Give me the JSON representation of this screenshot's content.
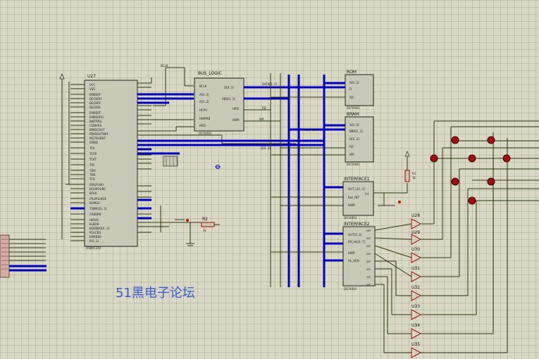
{
  "components": {
    "u27": {
      "title": "U27",
      "part": "DS80C320",
      "pins_left": [
        "VCC",
        "VSS",
        "EMBSRF",
        "DECKDH",
        "DECKRF",
        "DECKDL",
        "EMBSRT",
        "EMBSRRG",
        "BWTRRG",
        "CONVRR",
        "BMIDCOUT",
        "PRKSOUTNRF",
        "INSTRUENT",
        "EMBD",
        "TCK",
        "TCKR",
        "TCKT",
        "TDI",
        "TDO",
        "TMS",
        "TCB",
        "EMGPLNO",
        "BOLMOUBS",
        "BOLK",
        "CRLPULNGE",
        "BOMGE",
        "BOBOBT",
        "BMOMLIBE",
        "TSMB1[0..3]",
        "CREBRB",
        "HIOHS",
        "ELBOB",
        "BDEBDO[0..3]",
        "POLCEB",
        "EMRBEB",
        "TCDEN",
        "P[0..3]"
      ]
    },
    "bus_logic": {
      "title": "BUS_LOGIC",
      "part": "DS74091"
    },
    "rom": {
      "title": "ROM",
      "part": "DS74081"
    },
    "bram": {
      "title": "BRAM",
      "part": "DS74081"
    },
    "interface1": {
      "title": "INTERFACE1",
      "part": "DS74091"
    },
    "interface2": {
      "title": "INTERFACE2",
      "part": "DS74091"
    },
    "r1": {
      "title": "R1",
      "value": "1k"
    },
    "r2": {
      "title": "R2",
      "value": "1k"
    },
    "gates": [
      "U28",
      "U29",
      "U30",
      "U31",
      "U32",
      "U33",
      "U34",
      "U35"
    ]
  },
  "net_labels": [
    "BCLK",
    "DATA[0..7]",
    "ADDR[0..15]",
    "WR",
    "RD",
    "RB_TO[0..7]",
    "D[0..3]",
    "OUT_L[0..3]",
    "HL_DATA[0..7]"
  ],
  "watermark": "51黑电子论坛"
}
